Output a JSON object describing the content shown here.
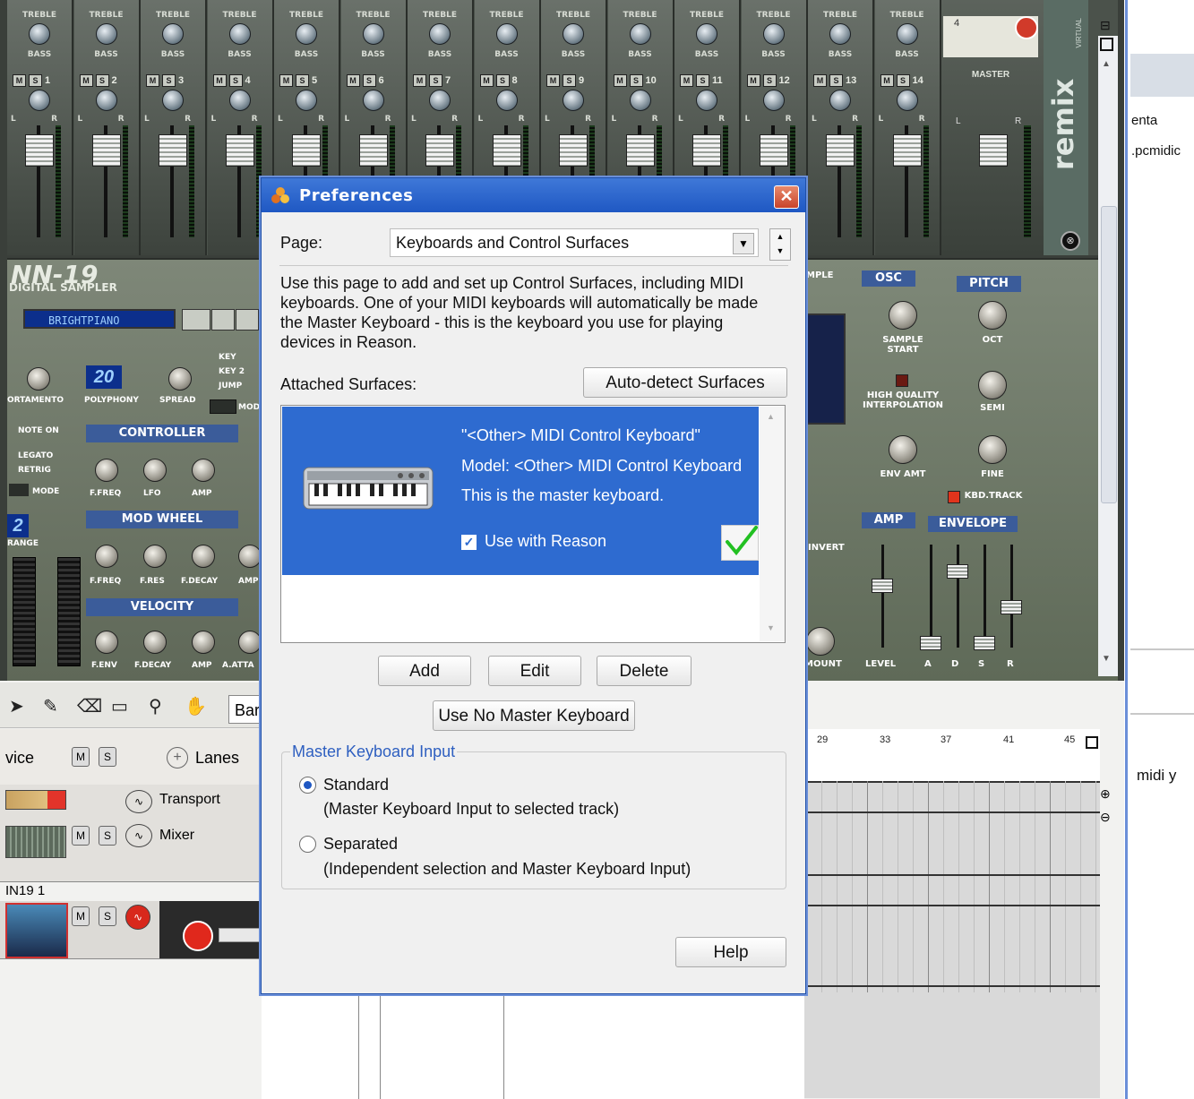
{
  "rack": {
    "channel_labels": [
      "1",
      "2",
      "3",
      "4",
      "5",
      "6",
      "7",
      "8",
      "9",
      "10",
      "11",
      "12",
      "13",
      "14"
    ],
    "strip_top_label": "TREBLE",
    "strip_bass_label": "BASS",
    "mute_label": "M",
    "solo_label": "S",
    "pan_left": "L",
    "pan_right": "R",
    "master_label": "MASTER",
    "master_channel_number": "4",
    "remix_logo": "remix",
    "remix_virtual": "VIRTUAL"
  },
  "nn19": {
    "logo": "NN-19",
    "subtitle": "DIGITAL SAMPLER",
    "patch_name": "BRIGHTPIANO",
    "polyphony_value": "20",
    "labels": {
      "portamento": "ORTAMENTO",
      "polyphony": "POLYPHONY",
      "spread": "SPREAD",
      "key": "KEY",
      "key2": "KEY 2",
      "jump": "JUMP",
      "mode_abbr": "MOD",
      "note_on": "NOTE ON",
      "legato": "LEGATO",
      "retrig": "RETRIG",
      "mode": "MODE",
      "controller": "CONTROLLER",
      "ffreq": "F.FREQ",
      "lfo": "LFO",
      "amp": "AMP",
      "mod_wheel": "MOD WHEEL",
      "range": "RANGE",
      "range_value": "2",
      "fres": "F.RES",
      "fdecay": "F.DECAY",
      "amp_abbr": "AMP",
      "velocity": "VELOCITY",
      "fenv": "F.ENV",
      "aatta": "A.ATTA"
    }
  },
  "synth_right": {
    "sample": "MPLE",
    "osc": "OSC",
    "pitch": "PITCH",
    "sample_start": "SAMPLE START",
    "oct": "OCT",
    "high_quality": "HIGH QUALITY INTERPOLATION",
    "semi": "SEMI",
    "env_amt": "ENV AMT",
    "fine": "FINE",
    "kbd_track": "KBD.TRACK",
    "amp": "AMP",
    "envelope": "ENVELOPE",
    "invert": "INVERT",
    "mount": "MOUNT",
    "level": "LEVEL",
    "env_labels": [
      "A",
      "D",
      "S",
      "R"
    ]
  },
  "right_pane": {
    "text1": "enta",
    "text2": ".pcmidic",
    "text3": "midi y"
  },
  "sequencer": {
    "bar_field": "Bar",
    "device_col": "vice",
    "lanes_label": "Lanes",
    "tracks": [
      {
        "name": "Transport"
      },
      {
        "name": "Mixer"
      }
    ],
    "track_tab": "IN19 1",
    "ruler": [
      "29",
      "33",
      "37",
      "41",
      "45"
    ]
  },
  "dialog": {
    "title": "Preferences",
    "close_glyph": "✕",
    "page_label": "Page:",
    "page_value": "Keyboards and Control Surfaces",
    "description": "Use this page to add and set up Control Surfaces, including MIDI keyboards. One of your MIDI keyboards will automatically be made the Master Keyboard - this is the keyboard you use for playing devices in Reason.",
    "attached_label": "Attached Surfaces:",
    "autodetect_label": "Auto-detect Surfaces",
    "surface": {
      "name": "\"<Other> MIDI Control Keyboard\"",
      "model": "Model: <Other> MIDI Control Keyboard",
      "status": "This is the master keyboard.",
      "use_label": "Use with Reason",
      "use_checked": true
    },
    "buttons": {
      "add": "Add",
      "edit": "Edit",
      "delete": "Delete",
      "no_master": "Use No Master Keyboard",
      "help": "Help"
    },
    "group": {
      "legend": "Master Keyboard Input",
      "options": [
        {
          "label": "Standard",
          "detail": "(Master Keyboard Input to selected track)",
          "selected": true
        },
        {
          "label": "Separated",
          "detail": "(Independent selection and Master Keyboard Input)",
          "selected": false
        }
      ]
    },
    "accent_color": "#1f58c3",
    "selection_color": "#2e6bd0"
  }
}
